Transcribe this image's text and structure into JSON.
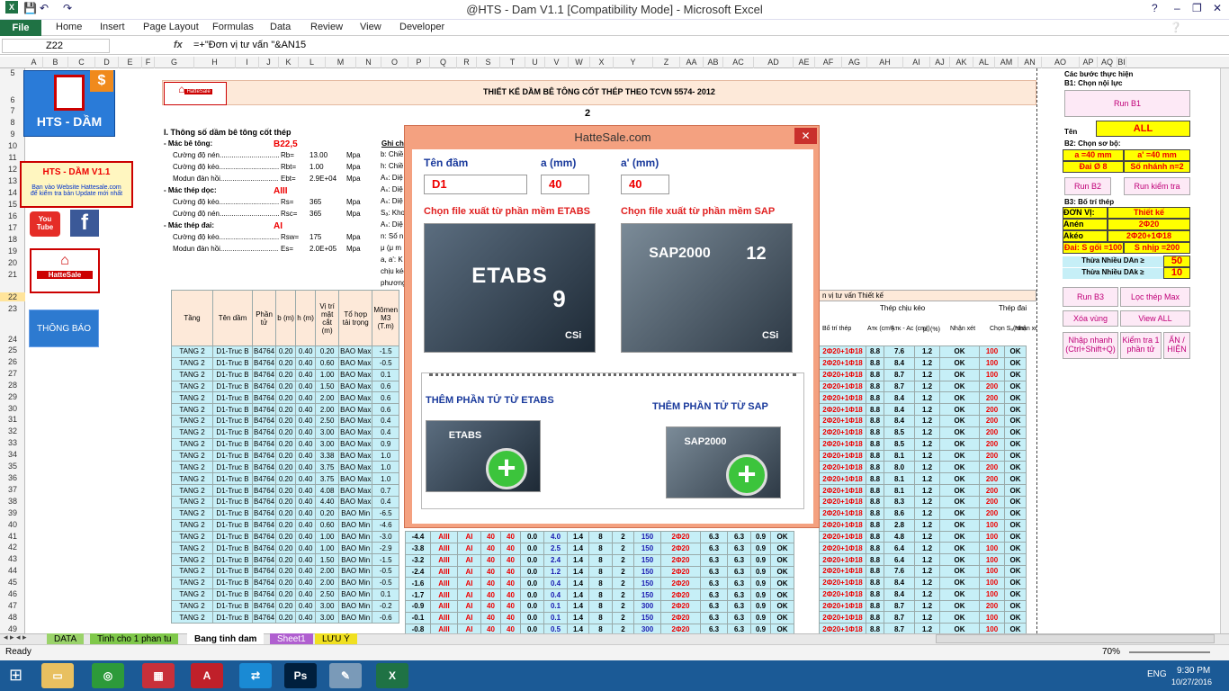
{
  "window": {
    "title": "@HTS - Dam V1.1  [Compatibility Mode] - Microsoft Excel",
    "controls": [
      "?",
      "–",
      "❐",
      "✕"
    ]
  },
  "ribbon": {
    "file": "File",
    "tabs": [
      "Home",
      "Insert",
      "Page Layout",
      "Formulas",
      "Data",
      "Review",
      "View",
      "Developer"
    ]
  },
  "formula_bar": {
    "name_box": "Z22",
    "fx": "fx",
    "formula": "=+\"Đơn vị tư vấn \"&AN15"
  },
  "columns": [
    "A",
    "B",
    "C",
    "D",
    "E",
    "F",
    "G",
    "H",
    "I",
    "J",
    "K",
    "L",
    "M",
    "N",
    "O",
    "P",
    "Q",
    "R",
    "S",
    "T",
    "U",
    "V",
    "W",
    "X",
    "Y",
    "Z",
    "AA",
    "AB",
    "AC",
    "AD",
    "AE",
    "AF",
    "AG",
    "AH",
    "AI",
    "AJ",
    "AK",
    "AL",
    "AM",
    "AN",
    "AO",
    "AP",
    "AQ",
    "BI"
  ],
  "rows": [
    "5",
    "6",
    "7",
    "8",
    "9",
    "10",
    "11",
    "12",
    "13",
    "14",
    "15",
    "16",
    "17",
    "18",
    "19",
    "20",
    "21",
    "22",
    "23",
    "24",
    "25",
    "26",
    "27",
    "28",
    "29",
    "30",
    "31",
    "32",
    "33",
    "34",
    "35",
    "36",
    "37",
    "38",
    "39",
    "40",
    "41",
    "42",
    "43",
    "44",
    "45",
    "46",
    "47",
    "48",
    "49"
  ],
  "logos": {
    "hts_dam": "HTS - DẦM",
    "version_box": "HTS - DẦM V1.1",
    "version_note1": "Bạn vào Website Hattesale.com",
    "version_note2": "để kiểm tra bản Update mới nhất",
    "youtube": "You Tube",
    "facebook": "f",
    "hattesale": "HatteSale",
    "notify": "THÔNG BÁO"
  },
  "sheet": {
    "title": "THIẾT KẾ DẦM BÊ TÔNG CỐT THÉP THEO TCVN 5574- 2012",
    "section1": "I. Thông số dầm bê tông cốt thép",
    "ghi_chu": "Ghi ch",
    "params": [
      {
        "name": "- Mác bê tông:",
        "sym": "",
        "val": "B22,5",
        "unit": "",
        "red": true
      },
      {
        "name": "Cường độ nén..............................",
        "sym": "Rb=",
        "val": "13.00",
        "unit": "Mpa",
        "red": false
      },
      {
        "name": "Cường độ kéo..............................",
        "sym": "Rbt=",
        "val": "1.00",
        "unit": "Mpa",
        "red": false
      },
      {
        "name": "Modun đàn hồi.............................",
        "sym": "Ebt=",
        "val": "2.9E+04",
        "unit": "Mpa",
        "red": false
      },
      {
        "name": "- Mác thép dọc:",
        "sym": "",
        "val": "AIII",
        "unit": "",
        "red": true
      },
      {
        "name": "Cường độ kéo..............................",
        "sym": "Rs=",
        "val": "365",
        "unit": "Mpa",
        "red": false
      },
      {
        "name": "Cường độ nén..............................",
        "sym": "Rsc=",
        "val": "365",
        "unit": "Mpa",
        "red": false
      },
      {
        "name": "- Mác thép đai:",
        "sym": "",
        "val": "AI",
        "unit": "",
        "red": true
      },
      {
        "name": "Cường độ kéo..............................",
        "sym": "Rsw=",
        "val": "175",
        "unit": "Mpa",
        "red": false
      },
      {
        "name": "Modun đàn hồi.............................",
        "sym": "Es=",
        "val": "2.0E+05",
        "unit": "Mpa",
        "red": false
      }
    ],
    "notes": [
      "b: Chiề",
      "h: Chiề",
      "Aₛ: Diệ",
      "Aₛ: Diệ",
      "Aₛ: Diệ",
      "Sₐ: Kho",
      "Aₛ: Diệ",
      "n: Số n",
      "μ (μ m",
      "a, a': K",
      "chịu kéo",
      "phương"
    ],
    "marker": "2",
    "headers": [
      "Tầng",
      "Tên dầm",
      "Phần tử",
      "b (m)",
      "h (m)",
      "Vị trí mặt cắt (m)",
      "Tổ hợp tải trọng",
      "Mômen M3 (T.m)"
    ],
    "right_band": "n vị tư vấn Thiết kế",
    "right_headers": [
      "Bố trí thép",
      "Aᴛᴋ (cm²)",
      "Aᴛᴋ - Aᴄ (cm²)",
      "μₜ (%)",
      "Nhận xét",
      "Chọn Sₐ(mm",
      "Nhận xét"
    ],
    "group_headers": [
      "Thép chịu kéo",
      "Thép đai"
    ],
    "rows": [
      [
        "TANG 2",
        "D1-Truc B",
        "B4764",
        "0.20",
        "0.40",
        "0.20",
        "BAO Max",
        "-1.5"
      ],
      [
        "TANG 2",
        "D1-Truc B",
        "B4764",
        "0.20",
        "0.40",
        "0.60",
        "BAO Max",
        "-0.5"
      ],
      [
        "TANG 2",
        "D1-Truc B",
        "B4764",
        "0.20",
        "0.40",
        "1.00",
        "BAO Max",
        "0.1"
      ],
      [
        "TANG 2",
        "D1-Truc B",
        "B4764",
        "0.20",
        "0.40",
        "1.50",
        "BAO Max",
        "0.6"
      ],
      [
        "TANG 2",
        "D1-Truc B",
        "B4764",
        "0.20",
        "0.40",
        "2.00",
        "BAO Max",
        "0.6"
      ],
      [
        "TANG 2",
        "D1-Truc B",
        "B4764",
        "0.20",
        "0.40",
        "2.00",
        "BAO Max",
        "0.6"
      ],
      [
        "TANG 2",
        "D1-Truc B",
        "B4764",
        "0.20",
        "0.40",
        "2.50",
        "BAO Max",
        "0.4"
      ],
      [
        "TANG 2",
        "D1-Truc B",
        "B4764",
        "0.20",
        "0.40",
        "3.00",
        "BAO Max",
        "0.4"
      ],
      [
        "TANG 2",
        "D1-Truc B",
        "B4764",
        "0.20",
        "0.40",
        "3.00",
        "BAO Max",
        "0.9"
      ],
      [
        "TANG 2",
        "D1-Truc B",
        "B4764",
        "0.20",
        "0.40",
        "3.38",
        "BAO Max",
        "1.0"
      ],
      [
        "TANG 2",
        "D1-Truc B",
        "B4764",
        "0.20",
        "0.40",
        "3.75",
        "BAO Max",
        "1.0"
      ],
      [
        "TANG 2",
        "D1-Truc B",
        "B4764",
        "0.20",
        "0.40",
        "3.75",
        "BAO Max",
        "1.0"
      ],
      [
        "TANG 2",
        "D1-Truc B",
        "B4764",
        "0.20",
        "0.40",
        "4.08",
        "BAO Max",
        "0.7"
      ],
      [
        "TANG 2",
        "D1-Truc B",
        "B4764",
        "0.20",
        "0.40",
        "4.40",
        "BAO Max",
        "0.4"
      ],
      [
        "TANG 2",
        "D1-Truc B",
        "B4764",
        "0.20",
        "0.40",
        "0.20",
        "BAO Min",
        "-6.5"
      ],
      [
        "TANG 2",
        "D1-Truc B",
        "B4764",
        "0.20",
        "0.40",
        "0.60",
        "BAO Min",
        "-4.6"
      ],
      [
        "TANG 2",
        "D1-Truc B",
        "B4764",
        "0.20",
        "0.40",
        "1.00",
        "BAO Min",
        "-3.0"
      ],
      [
        "TANG 2",
        "D1-Truc B",
        "B4764",
        "0.20",
        "0.40",
        "1.00",
        "BAO Min",
        "-2.9"
      ],
      [
        "TANG 2",
        "D1-Truc B",
        "B4764",
        "0.20",
        "0.40",
        "1.50",
        "BAO Min",
        "-1.5"
      ],
      [
        "TANG 2",
        "D1-Truc B",
        "B4764",
        "0.20",
        "0.40",
        "2.00",
        "BAO Min",
        "-0.5"
      ],
      [
        "TANG 2",
        "D1-Truc B",
        "B4764",
        "0.20",
        "0.40",
        "2.00",
        "BAO Min",
        "-0.5"
      ],
      [
        "TANG 2",
        "D1-Truc B",
        "B4764",
        "0.20",
        "0.40",
        "2.50",
        "BAO Min",
        "0.1"
      ],
      [
        "TANG 2",
        "D1-Truc B",
        "B4764",
        "0.20",
        "0.40",
        "3.00",
        "BAO Min",
        "-0.2"
      ],
      [
        "TANG 2",
        "D1-Truc B",
        "B4764",
        "0.20",
        "0.40",
        "3.00",
        "BAO Min",
        "-0.6"
      ]
    ],
    "right_rows": [
      [
        "2Φ20+1Φ18",
        "8.8",
        "7.6",
        "1.2",
        "OK",
        "100",
        "OK"
      ],
      [
        "2Φ20+1Φ18",
        "8.8",
        "8.4",
        "1.2",
        "OK",
        "100",
        "OK"
      ],
      [
        "2Φ20+1Φ18",
        "8.8",
        "8.7",
        "1.2",
        "OK",
        "100",
        "OK"
      ],
      [
        "2Φ20+1Φ18",
        "8.8",
        "8.7",
        "1.2",
        "OK",
        "200",
        "OK"
      ],
      [
        "2Φ20+1Φ18",
        "8.8",
        "8.4",
        "1.2",
        "OK",
        "200",
        "OK"
      ],
      [
        "2Φ20+1Φ18",
        "8.8",
        "8.4",
        "1.2",
        "OK",
        "200",
        "OK"
      ],
      [
        "2Φ20+1Φ18",
        "8.8",
        "8.4",
        "1.2",
        "OK",
        "200",
        "OK"
      ],
      [
        "2Φ20+1Φ18",
        "8.8",
        "8.5",
        "1.2",
        "OK",
        "200",
        "OK"
      ],
      [
        "2Φ20+1Φ18",
        "8.8",
        "8.5",
        "1.2",
        "OK",
        "200",
        "OK"
      ],
      [
        "2Φ20+1Φ18",
        "8.8",
        "8.1",
        "1.2",
        "OK",
        "200",
        "OK"
      ],
      [
        "2Φ20+1Φ18",
        "8.8",
        "8.0",
        "1.2",
        "OK",
        "200",
        "OK"
      ],
      [
        "2Φ20+1Φ18",
        "8.8",
        "8.1",
        "1.2",
        "OK",
        "200",
        "OK"
      ],
      [
        "2Φ20+1Φ18",
        "8.8",
        "8.1",
        "1.2",
        "OK",
        "200",
        "OK"
      ],
      [
        "2Φ20+1Φ18",
        "8.8",
        "8.3",
        "1.2",
        "OK",
        "200",
        "OK"
      ],
      [
        "2Φ20+1Φ18",
        "8.8",
        "8.6",
        "1.2",
        "OK",
        "200",
        "OK"
      ],
      [
        "2Φ20+1Φ18",
        "8.8",
        "2.8",
        "1.2",
        "OK",
        "100",
        "OK"
      ],
      [
        "2Φ20+1Φ18",
        "8.8",
        "4.8",
        "1.2",
        "OK",
        "100",
        "OK"
      ],
      [
        "2Φ20+1Φ18",
        "8.8",
        "6.4",
        "1.2",
        "OK",
        "100",
        "OK"
      ],
      [
        "2Φ20+1Φ18",
        "8.8",
        "6.4",
        "1.2",
        "OK",
        "100",
        "OK"
      ],
      [
        "2Φ20+1Φ18",
        "8.8",
        "7.6",
        "1.2",
        "OK",
        "100",
        "OK"
      ],
      [
        "2Φ20+1Φ18",
        "8.8",
        "8.4",
        "1.2",
        "OK",
        "100",
        "OK"
      ],
      [
        "2Φ20+1Φ18",
        "8.8",
        "8.4",
        "1.2",
        "OK",
        "100",
        "OK"
      ],
      [
        "2Φ20+1Φ18",
        "8.8",
        "8.7",
        "1.2",
        "OK",
        "200",
        "OK"
      ],
      [
        "2Φ20+1Φ18",
        "8.8",
        "8.7",
        "1.2",
        "OK",
        "100",
        "OK"
      ],
      [
        "2Φ20+1Φ18",
        "8.8",
        "8.7",
        "1.2",
        "OK",
        "100",
        "OK"
      ]
    ],
    "bottom_rows": [
      [
        "-4.4",
        "AIII",
        "AI",
        "40",
        "40",
        "0.0",
        "4.0",
        "1.4",
        "8",
        "2",
        "150",
        "2Φ20",
        "6.3",
        "6.3",
        "0.9",
        "OK"
      ],
      [
        "-3.8",
        "AIII",
        "AI",
        "40",
        "40",
        "0.0",
        "2.5",
        "1.4",
        "8",
        "2",
        "150",
        "2Φ20",
        "6.3",
        "6.3",
        "0.9",
        "OK"
      ],
      [
        "-3.2",
        "AIII",
        "AI",
        "40",
        "40",
        "0.0",
        "2.4",
        "1.4",
        "8",
        "2",
        "150",
        "2Φ20",
        "6.3",
        "6.3",
        "0.9",
        "OK"
      ],
      [
        "-2.4",
        "AIII",
        "AI",
        "40",
        "40",
        "0.0",
        "1.2",
        "1.4",
        "8",
        "2",
        "150",
        "2Φ20",
        "6.3",
        "6.3",
        "0.9",
        "OK"
      ],
      [
        "-1.6",
        "AIII",
        "AI",
        "40",
        "40",
        "0.0",
        "0.4",
        "1.4",
        "8",
        "2",
        "150",
        "2Φ20",
        "6.3",
        "6.3",
        "0.9",
        "OK"
      ],
      [
        "-1.7",
        "AIII",
        "AI",
        "40",
        "40",
        "0.0",
        "0.4",
        "1.4",
        "8",
        "2",
        "150",
        "2Φ20",
        "6.3",
        "6.3",
        "0.9",
        "OK"
      ],
      [
        "-0.9",
        "AIII",
        "AI",
        "40",
        "40",
        "0.0",
        "0.1",
        "1.4",
        "8",
        "2",
        "300",
        "2Φ20",
        "6.3",
        "6.3",
        "0.9",
        "OK"
      ],
      [
        "-0.1",
        "AIII",
        "AI",
        "40",
        "40",
        "0.0",
        "0.1",
        "1.4",
        "8",
        "2",
        "150",
        "2Φ20",
        "6.3",
        "6.3",
        "0.9",
        "OK"
      ],
      [
        "-0.8",
        "AIII",
        "AI",
        "40",
        "40",
        "0.0",
        "0.5",
        "1.4",
        "8",
        "2",
        "300",
        "2Φ20",
        "6.3",
        "6.3",
        "0.9",
        "OK"
      ]
    ]
  },
  "panel": {
    "steps": "Các bước thực hiện",
    "b1": "B1: Chọn nội lực",
    "run_b1": "Run B1",
    "ten_label": "Tên",
    "ten_val": "ALL",
    "b2": "B2: Chọn sơ bộ:",
    "a": "a =40 mm",
    "a2": "a' =40 mm",
    "dai": "Đai Ø 8",
    "nhanh": "Số nhánh n=2",
    "run_b2": "Run B2",
    "run_kiemtra": "Run kiểm tra",
    "b3": "B3: Bố trí thép",
    "donvi_l": "ĐƠN VỊ:",
    "donvi_v": "Thiết kế",
    "anen_l": "Anén",
    "anen_v": "2Φ20",
    "akeo_l": "Akéo",
    "akeo_v": "2Φ20+1Φ18",
    "daiS": "Đai: S gối =100",
    "snhip": "S nhịp =200",
    "thua_an": "Thừa Nhiều  DAn ≥",
    "thua_an_v": "50",
    "thua_ak": "Thừa Nhiều  DAk ≥",
    "thua_ak_v": "10",
    "run_b3": "Run B3",
    "loc": "Lọc thép Max",
    "xoa": "Xóa vùng",
    "view": "View ALL",
    "nhap": "Nhập nhanh (Ctrl+Shift+Q)",
    "kiem": "Kiểm tra 1 phần tử",
    "an": "ẨN / HIỆN"
  },
  "dialog": {
    "title": "HatteSale.com",
    "close": "✕",
    "ten_dam_label": "Tên đầm",
    "a_label": "a (mm)",
    "a2_label": "a' (mm)",
    "ten_dam": "D1",
    "a": "40",
    "a2": "40",
    "etabs_label": "Chọn file xuất từ phần mềm ETABS",
    "sap_label": "Chọn file xuất từ phần mềm SAP",
    "etabs_img": "ETABS",
    "etabs_ver": "9",
    "sap_img": "SAP2000",
    "sap_ver": "12",
    "csi": "CSi",
    "add_etabs": "THÊM PHẦN TỬ TỪ ETABS",
    "add_sap": "THÊM PHẦN TỬ TỪ SAP",
    "plus": "+"
  },
  "sheet_tabs": [
    "DATA",
    "Tinh cho 1 phan tu",
    "Bang tinh dam",
    "Sheet1",
    "LƯU Ý"
  ],
  "status": {
    "ready": "Ready",
    "zoom": "70%"
  },
  "taskbar": {
    "lang": "ENG",
    "time": "9:30 PM",
    "date": "10/27/2016"
  }
}
